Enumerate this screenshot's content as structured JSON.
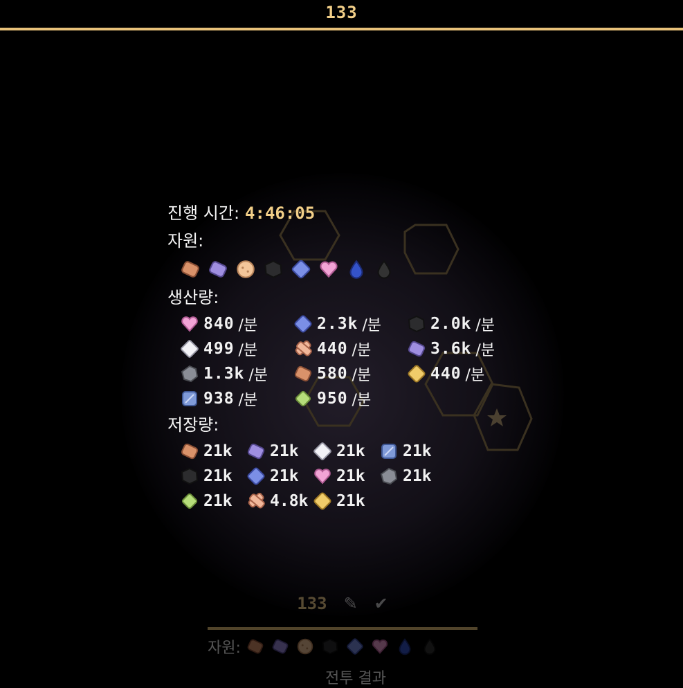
{
  "top_value": "133",
  "time": {
    "label": "진행 시간:",
    "value": "4:46:05"
  },
  "resources": {
    "label": "자원:",
    "items": [
      "copper-ingot",
      "iron-bar",
      "cookie",
      "coal",
      "sapphire",
      "heart-gem",
      "water-drop",
      "oil-drop"
    ]
  },
  "production": {
    "label": "생산량:",
    "unit": "/분",
    "rows": [
      [
        {
          "icon": "heart-gem",
          "value": "840"
        },
        {
          "icon": "sapphire",
          "value": "2.3k"
        },
        {
          "icon": "coal",
          "value": "2.0k"
        }
      ],
      [
        {
          "icon": "white-crystal",
          "value": "499"
        },
        {
          "icon": "wood-plank",
          "value": "440"
        },
        {
          "icon": "iron-bar",
          "value": "3.6k"
        }
      ],
      [
        {
          "icon": "stone",
          "value": "1.3k"
        },
        {
          "icon": "copper-ingot",
          "value": "580"
        },
        {
          "icon": "gold-bar",
          "value": "440"
        }
      ],
      [
        {
          "icon": "blue-block",
          "value": "938"
        },
        {
          "icon": "green-gem",
          "value": "950"
        }
      ]
    ]
  },
  "storage": {
    "label": "저장량:",
    "rows": [
      [
        {
          "icon": "copper-ingot",
          "value": "21k"
        },
        {
          "icon": "iron-bar",
          "value": "21k"
        },
        {
          "icon": "white-crystal",
          "value": "21k"
        },
        {
          "icon": "blue-block",
          "value": "21k"
        }
      ],
      [
        {
          "icon": "coal",
          "value": "21k"
        },
        {
          "icon": "sapphire",
          "value": "21k"
        },
        {
          "icon": "heart-gem",
          "value": "21k"
        },
        {
          "icon": "stone",
          "value": "21k"
        }
      ],
      [
        {
          "icon": "green-gem",
          "value": "21k"
        },
        {
          "icon": "wood-plank",
          "value": "4.8k"
        },
        {
          "icon": "gold-bar",
          "value": "21k"
        }
      ]
    ]
  },
  "background_panel": {
    "number": "133",
    "resources_label": "자원:",
    "bottom_text": "전투 결과"
  },
  "colors": {
    "accent": "#e9c27a",
    "time": "#f2cf88",
    "text": "#f2f2f2"
  }
}
